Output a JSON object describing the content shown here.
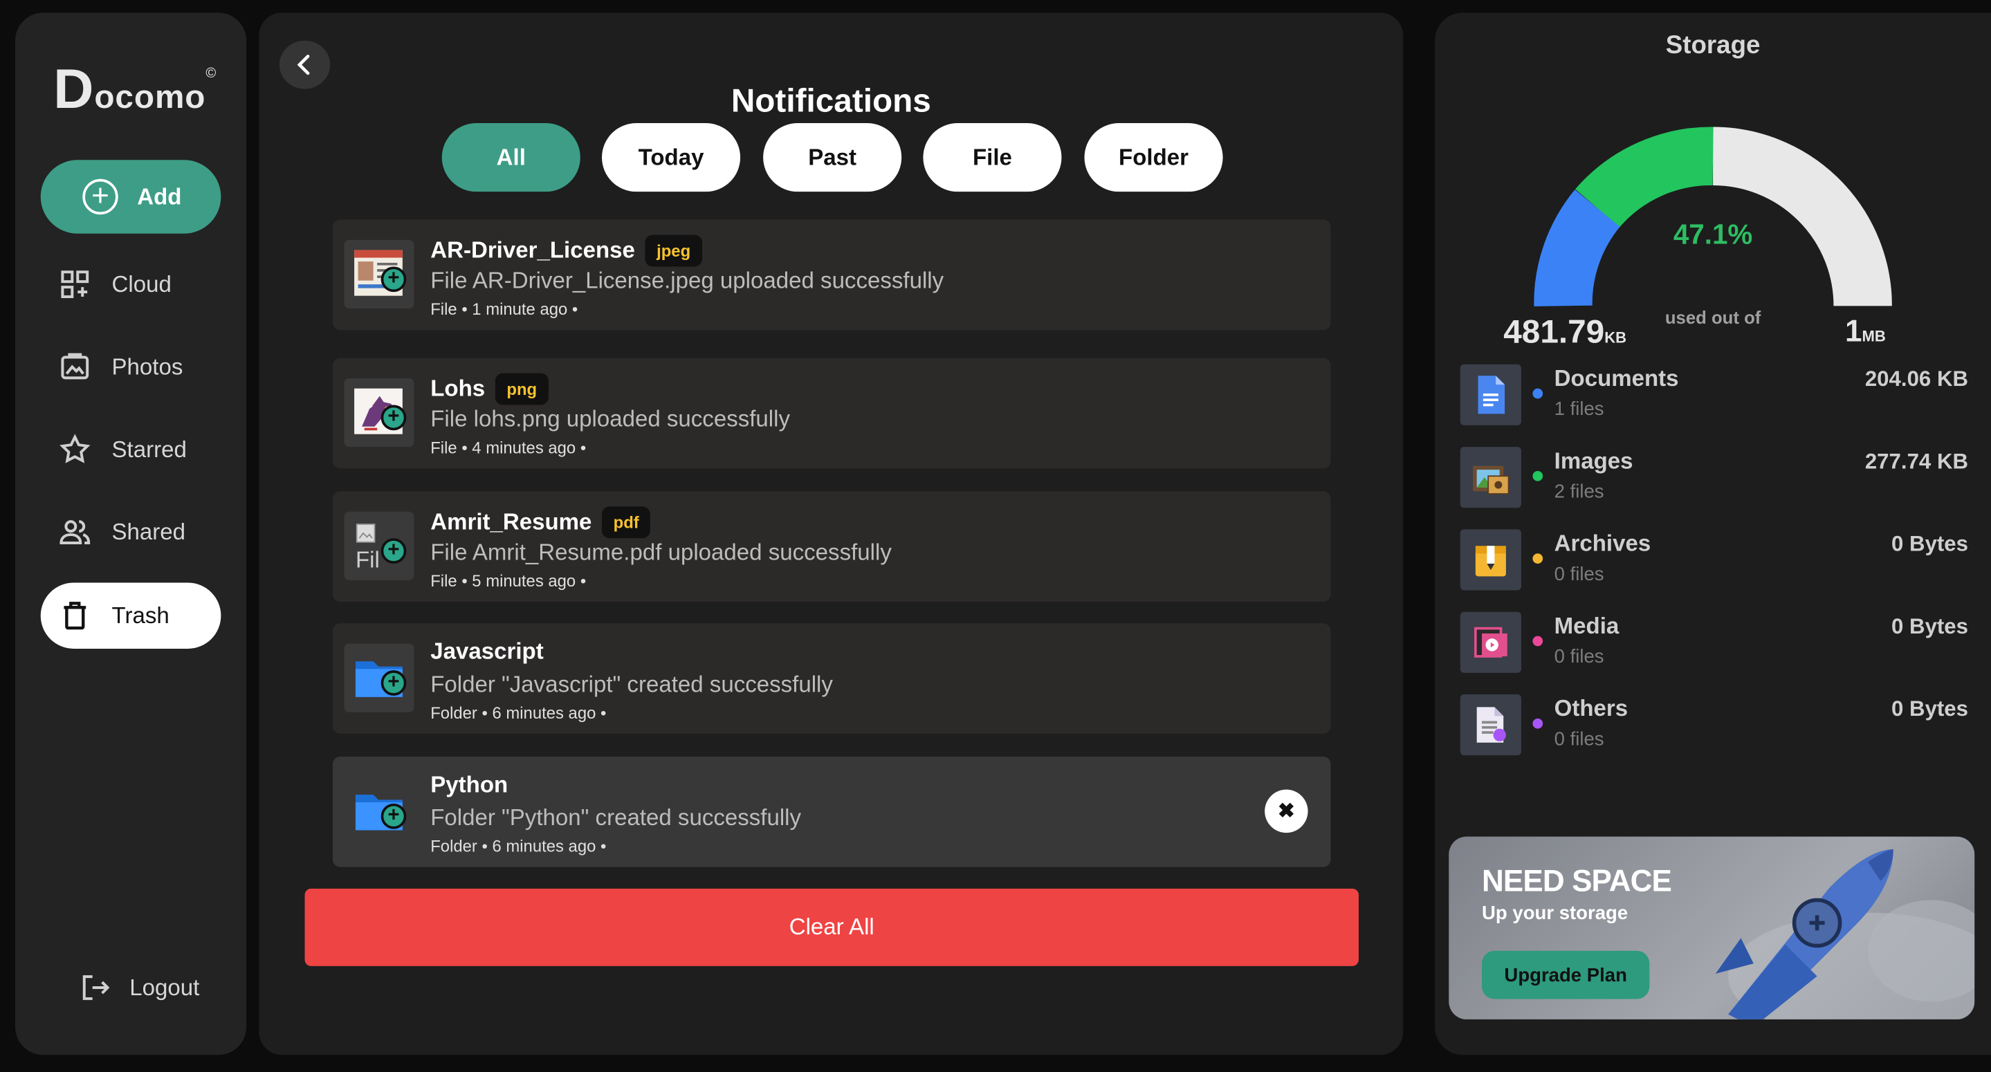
{
  "app": {
    "logo_letter": "D",
    "logo_rest": "ocomo",
    "logo_mark": "©"
  },
  "sidebar": {
    "add_label": "Add",
    "items": [
      {
        "label": "Cloud",
        "icon": "grid-plus-icon"
      },
      {
        "label": "Photos",
        "icon": "photo-icon"
      },
      {
        "label": "Starred",
        "icon": "star-icon"
      },
      {
        "label": "Shared",
        "icon": "users-icon"
      },
      {
        "label": "Trash",
        "icon": "trash-icon",
        "active": true
      }
    ],
    "logout_label": "Logout"
  },
  "notifications": {
    "title": "Notifications",
    "filters": [
      {
        "label": "All",
        "active": true
      },
      {
        "label": "Today"
      },
      {
        "label": "Past"
      },
      {
        "label": "File"
      },
      {
        "label": "Folder"
      }
    ],
    "items": [
      {
        "name": "AR-Driver_License",
        "badge": "jpeg",
        "message": "File AR-Driver_License.jpeg uploaded successfully",
        "meta": "File • 1 minute ago •"
      },
      {
        "name": "Lohs",
        "badge": "png",
        "message": "File lohs.png uploaded successfully",
        "meta": "File • 4 minutes ago •"
      },
      {
        "name": "Amrit_Resume",
        "badge": "pdf",
        "thumb_alt": "Fil",
        "message": "File Amrit_Resume.pdf uploaded successfully",
        "meta": "File • 5 minutes ago •"
      },
      {
        "name": "Javascript",
        "message": "Folder \"Javascript\" created successfully",
        "meta": "Folder • 6 minutes ago •"
      },
      {
        "name": "Python",
        "message": "Folder \"Python\" created successfully",
        "meta": "Folder • 6 minutes ago •"
      }
    ],
    "clear_label": "Clear All"
  },
  "storage": {
    "title": "Storage",
    "percent": "47.1%",
    "used_of": "used out of",
    "used_value": "481.79",
    "used_unit": "KB",
    "total_value": "1",
    "total_unit": "MB",
    "categories": [
      {
        "name": "Documents",
        "count": "1 files",
        "size": "204.06 KB",
        "color": "#3b82f6"
      },
      {
        "name": "Images",
        "count": "2 files",
        "size": "277.74 KB",
        "color": "#22c55e"
      },
      {
        "name": "Archives",
        "count": "0 files",
        "size": "0 Bytes",
        "color": "#f5b731"
      },
      {
        "name": "Media",
        "count": "0 files",
        "size": "0 Bytes",
        "color": "#ec4899"
      },
      {
        "name": "Others",
        "count": "0 files",
        "size": "0 Bytes",
        "color": "#a855f7"
      }
    ],
    "gauge_colors": {
      "documents": "#3b82f6",
      "images": "#22c55e",
      "free": "#e8e8e8"
    },
    "promo": {
      "heading": "NEED SPACE",
      "subtitle": "Up your storage",
      "button": "Upgrade Plan"
    }
  }
}
